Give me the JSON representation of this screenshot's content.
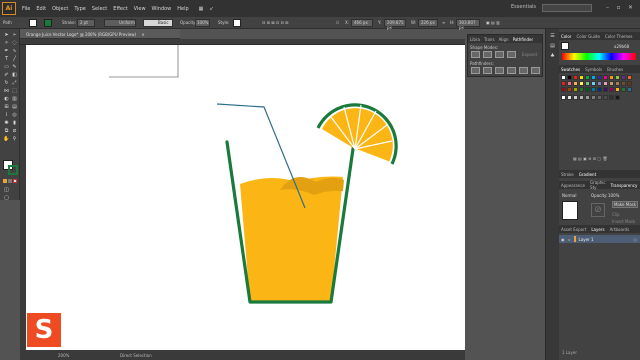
{
  "app": {
    "logo": "Ai",
    "menu": [
      "File",
      "Edit",
      "Object",
      "Type",
      "Select",
      "Effect",
      "View",
      "Window",
      "Help"
    ],
    "workspace": "Essentials"
  },
  "controlbar": {
    "selection_label": "Path",
    "stroke_label": "Stroke:",
    "stroke_weight": "2 pt",
    "stroke_profile": "Uniform",
    "brush": "Basic",
    "opacity_label": "Opacity:",
    "opacity_value": "100%",
    "style_label": "Style:",
    "x_value": "466 px",
    "y_value": "209.875 px",
    "w_value": "226 px",
    "h_value": "303.807 px"
  },
  "document": {
    "tab_title": "Orange Juice Vector Logo* @ 200% (RGB/GPU Preview)",
    "zoom": "200%",
    "status_tool": "Direct Selection"
  },
  "pathfinder_panel": {
    "tabs": [
      "Libra",
      "Trans",
      "Align",
      "Pathfinder"
    ],
    "active_tab": "Pathfinder",
    "shape_modes_label": "Shape Modes:",
    "pathfinders_label": "Pathfinders:",
    "expand_label": "Expand"
  },
  "dock": {
    "color_tabs": [
      "Color",
      "Color Guide",
      "Color Themes"
    ],
    "hex_value": "a29b68",
    "swatch_tabs": [
      "Swatches",
      "Symbols",
      "Brushes"
    ],
    "stroke_tabs": [
      "Stroke",
      "Gradient"
    ],
    "transparency_tabs": [
      "Appearance",
      "Graphic Sty",
      "Transparency"
    ],
    "blend_mode": "Normal",
    "opacity_label": "Opacity:",
    "opacity_value": "100%",
    "make_mask_label": "Make Mask",
    "clip_label": "Clip",
    "invert_label": "Invert Mask",
    "layers_tabs": [
      "Asset Export",
      "Layers",
      "Artboards"
    ],
    "layer_name": "Layer 1",
    "layers_count": "1 Layer"
  },
  "colors": {
    "accent": "#e89a2e",
    "juice": "#fbb615",
    "juice_dark": "#e3a011",
    "glass_green": "#1a7a3b",
    "straw": "#2e6f8a",
    "brand": "#ee4b22"
  },
  "brand": {
    "mark": "S"
  }
}
